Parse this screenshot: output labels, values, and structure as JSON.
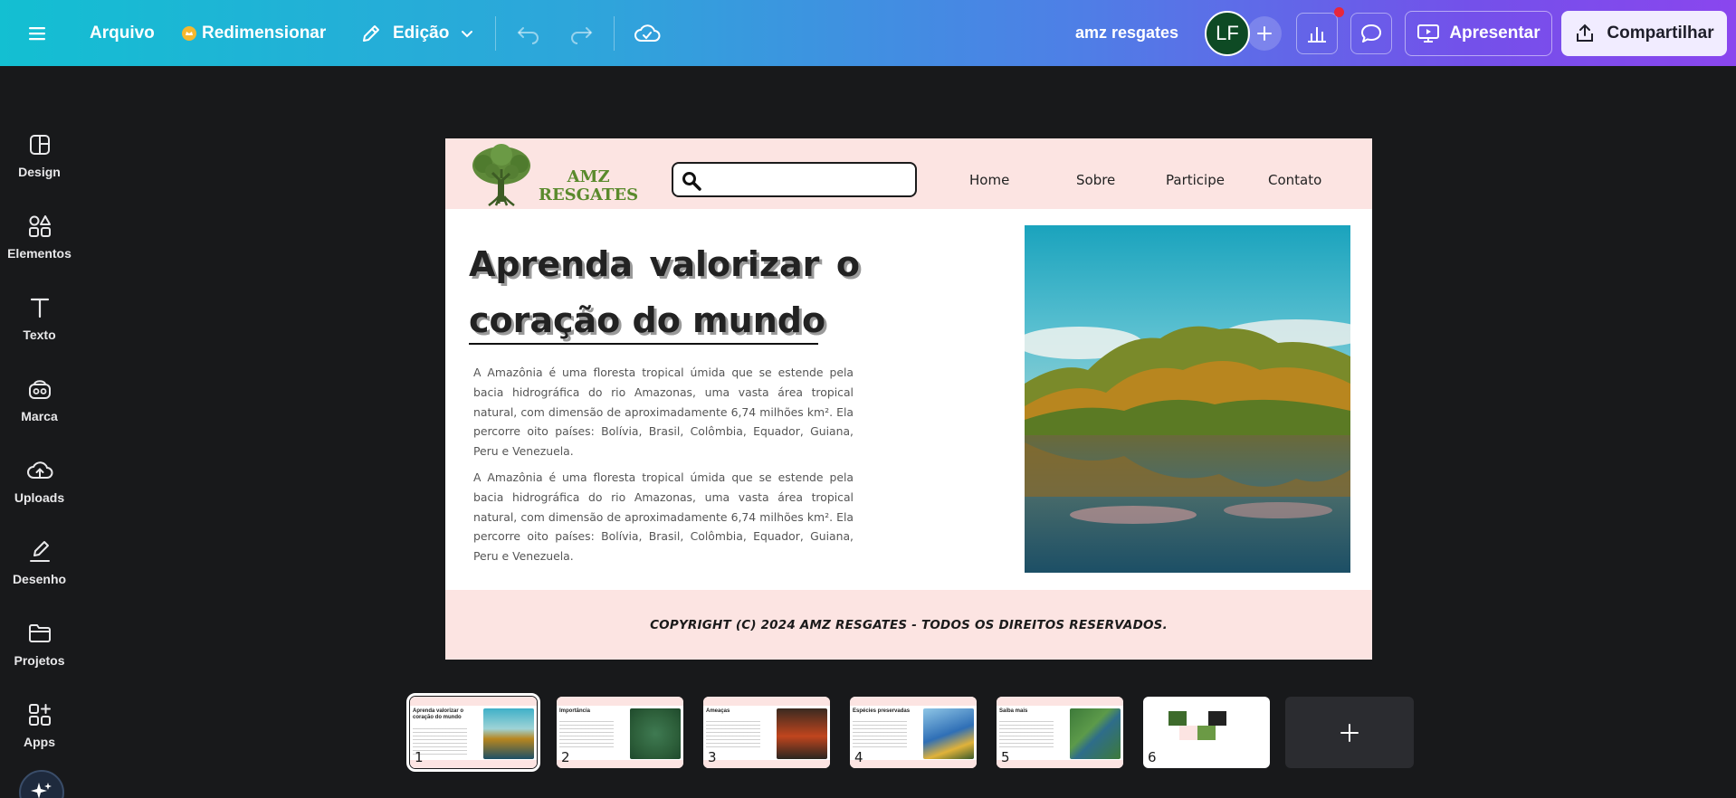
{
  "topbar": {
    "menu_icon": "hamburger-icon",
    "file_label": "Arquivo",
    "resize_label": "Redimensionar",
    "edit_label": "Edição",
    "doc_title": "amz resgates",
    "avatar_initials": "LF",
    "present_label": "Apresentar",
    "share_label": "Compartilhar"
  },
  "sidebar": {
    "items": [
      {
        "label": "Design",
        "icon": "layout-icon"
      },
      {
        "label": "Elementos",
        "icon": "shapes-icon"
      },
      {
        "label": "Texto",
        "icon": "text-icon"
      },
      {
        "label": "Marca",
        "icon": "brand-icon"
      },
      {
        "label": "Uploads",
        "icon": "cloud-upload-icon"
      },
      {
        "label": "Desenho",
        "icon": "draw-icon"
      },
      {
        "label": "Projetos",
        "icon": "folder-icon"
      },
      {
        "label": "Apps",
        "icon": "apps-icon"
      }
    ]
  },
  "page": {
    "logo_line1": "AMZ",
    "logo_line2": "RESGATES",
    "nav": [
      "Home",
      "Sobre",
      "Participe",
      "Contato"
    ],
    "headline_line1_words": [
      "Aprenda",
      "valorizar",
      "o"
    ],
    "headline_line2": "coração do mundo",
    "paragraph1": "A Amazônia é uma floresta tropical úmida que se estende pela bacia hidrográfica do rio Amazonas, uma vasta área tropical natural, com dimensão de aproximadamente 6,74 milhões km². Ela percorre oito países: Bolívia, Brasil, Colômbia, Equador, Guiana, Peru e Venezuela.",
    "paragraph2": "A Amazônia é uma floresta tropical úmida que se estende pela bacia hidrográfica do rio Amazonas, uma vasta área tropical natural, com dimensão de aproximadamente 6,74 milhões km². Ela percorre oito países: Bolívia, Brasil, Colômbia, Equador, Guiana, Peru e Venezuela.",
    "footer": "COPYRIGHT (C) 2024 AMZ RESGATES - TODOS OS DIREITOS RESERVADOS."
  },
  "thumbnails": [
    {
      "num": "1",
      "title": "Aprenda valorizar o coração do mundo"
    },
    {
      "num": "2",
      "title": "Importância"
    },
    {
      "num": "3",
      "title": "Ameaças"
    },
    {
      "num": "4",
      "title": "Espécies preservadas"
    },
    {
      "num": "5",
      "title": "Saiba mais"
    },
    {
      "num": "6",
      "title": ""
    }
  ],
  "colors": {
    "page_header_bg": "#fce4e2",
    "logo_green": "#5a8a2c",
    "brand_gradient_start": "#13bfd2",
    "brand_gradient_end": "#8a46ee"
  }
}
